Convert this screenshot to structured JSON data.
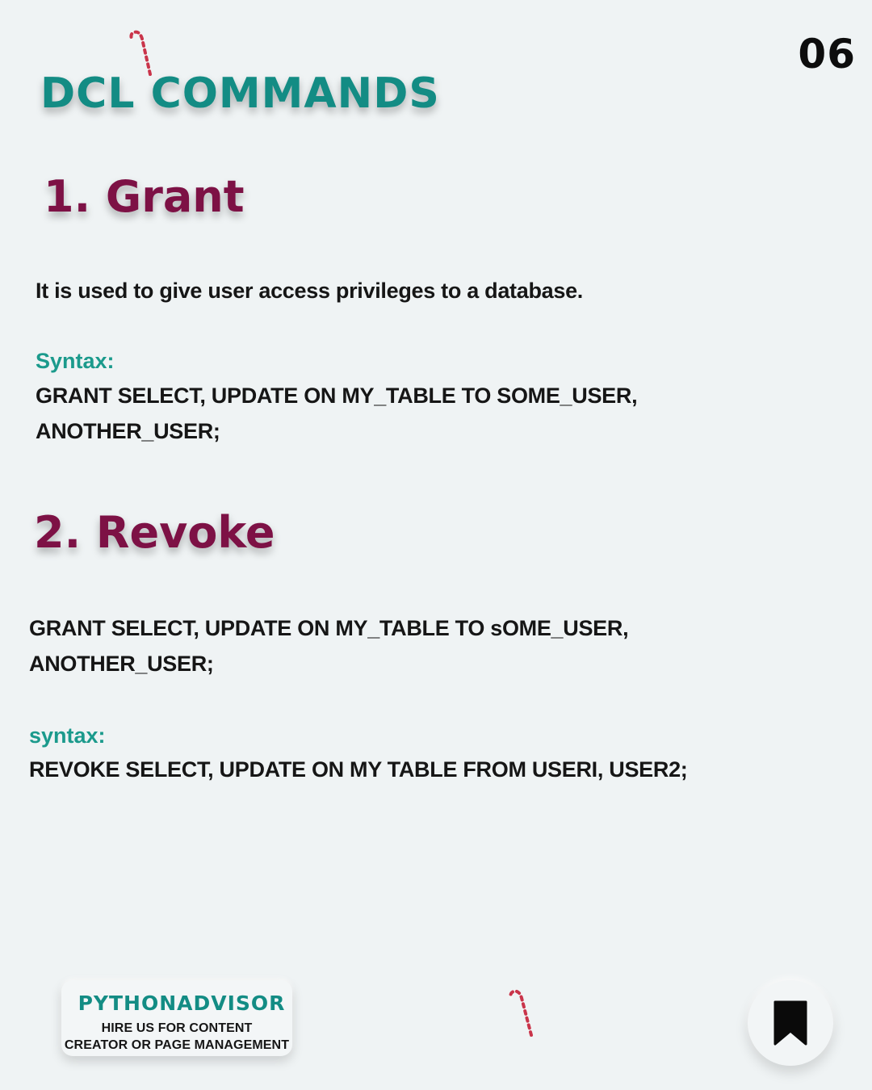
{
  "page_number": "06",
  "title": "DCL COMMANDS",
  "sections": [
    {
      "heading": "1. Grant",
      "description": "It is used to give user access privileges to a database.",
      "syntax_label": "Syntax:",
      "syntax_lines": [
        "GRANT SELECT, UPDATE ON MY_TABLE TO SOME_USER,",
        "ANOTHER_USER;"
      ]
    },
    {
      "heading": "2. Revoke",
      "description_lines": [
        "GRANT SELECT, UPDATE ON MY_TABLE TO sOME_USER,",
        "ANOTHER_USER;"
      ],
      "syntax_label": "syntax:",
      "syntax_lines": [
        "REVOKE SELECT, UPDATE ON MY TABLE FROM USERI, USER2;"
      ]
    }
  ],
  "footer": {
    "brand": "PYTHONADVISOR",
    "tagline_lines": [
      "HIRE US FOR CONTENT",
      "CREATOR OR PAGE MANAGEMENT"
    ]
  },
  "icons": {
    "decoration": "candy-cane-icon",
    "save": "bookmark-icon"
  },
  "colors": {
    "background": "#eff3f4",
    "title": "#138c84",
    "section_heading": "#7d1145",
    "syntax_label": "#1b9a8c",
    "body_text": "#161616"
  }
}
